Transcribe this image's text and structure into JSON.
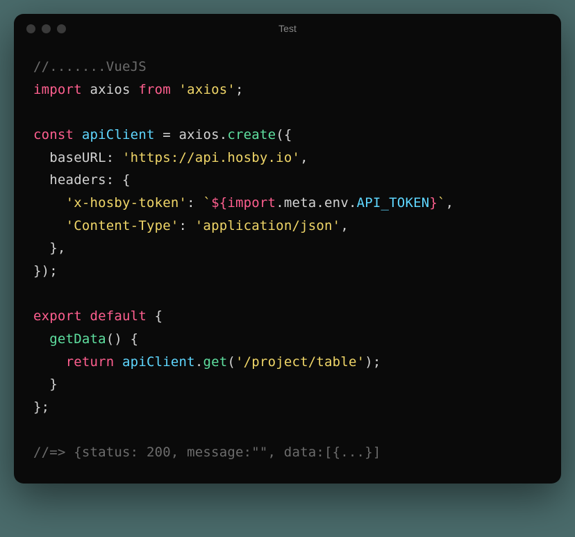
{
  "window": {
    "title": "Test"
  },
  "code": {
    "lines": [
      {
        "segments": [
          {
            "cls": "c-comment",
            "t": "//.......VueJS"
          }
        ]
      },
      {
        "segments": [
          {
            "cls": "c-keyword",
            "t": "import"
          },
          {
            "cls": "c-import-name",
            "t": " axios "
          },
          {
            "cls": "c-keyword",
            "t": "from"
          },
          {
            "cls": "c-punct",
            "t": " "
          },
          {
            "cls": "c-string",
            "t": "'axios'"
          },
          {
            "cls": "c-punct",
            "t": ";"
          }
        ]
      },
      {
        "segments": [
          {
            "cls": "c-punct",
            "t": " "
          }
        ]
      },
      {
        "segments": [
          {
            "cls": "c-keyword",
            "t": "const"
          },
          {
            "cls": "c-punct",
            "t": " "
          },
          {
            "cls": "c-var",
            "t": "apiClient"
          },
          {
            "cls": "c-punct",
            "t": " = axios."
          },
          {
            "cls": "c-func",
            "t": "create"
          },
          {
            "cls": "c-punct",
            "t": "({"
          }
        ]
      },
      {
        "segments": [
          {
            "cls": "c-punct",
            "t": "  "
          },
          {
            "cls": "c-prop",
            "t": "baseURL"
          },
          {
            "cls": "c-punct",
            "t": ": "
          },
          {
            "cls": "c-string",
            "t": "'https://api.hosby.io'"
          },
          {
            "cls": "c-punct",
            "t": ","
          }
        ]
      },
      {
        "segments": [
          {
            "cls": "c-punct",
            "t": "  "
          },
          {
            "cls": "c-prop",
            "t": "headers"
          },
          {
            "cls": "c-punct",
            "t": ": {"
          }
        ]
      },
      {
        "segments": [
          {
            "cls": "c-punct",
            "t": "    "
          },
          {
            "cls": "c-string",
            "t": "'x-hosby-token'"
          },
          {
            "cls": "c-punct",
            "t": ": "
          },
          {
            "cls": "c-string",
            "t": "`"
          },
          {
            "cls": "c-templ",
            "t": "${"
          },
          {
            "cls": "c-keyword",
            "t": "import"
          },
          {
            "cls": "c-punct",
            "t": "."
          },
          {
            "cls": "c-meta",
            "t": "meta"
          },
          {
            "cls": "c-punct",
            "t": "."
          },
          {
            "cls": "c-meta",
            "t": "env"
          },
          {
            "cls": "c-punct",
            "t": "."
          },
          {
            "cls": "c-env",
            "t": "API_TOKEN"
          },
          {
            "cls": "c-templ",
            "t": "}"
          },
          {
            "cls": "c-string",
            "t": "`"
          },
          {
            "cls": "c-punct",
            "t": ","
          }
        ]
      },
      {
        "segments": [
          {
            "cls": "c-punct",
            "t": "    "
          },
          {
            "cls": "c-string",
            "t": "'Content-Type'"
          },
          {
            "cls": "c-punct",
            "t": ": "
          },
          {
            "cls": "c-string",
            "t": "'application/json'"
          },
          {
            "cls": "c-punct",
            "t": ","
          }
        ]
      },
      {
        "segments": [
          {
            "cls": "c-punct",
            "t": "  },"
          }
        ]
      },
      {
        "segments": [
          {
            "cls": "c-punct",
            "t": "});"
          }
        ]
      },
      {
        "segments": [
          {
            "cls": "c-punct",
            "t": " "
          }
        ]
      },
      {
        "segments": [
          {
            "cls": "c-keyword",
            "t": "export"
          },
          {
            "cls": "c-punct",
            "t": " "
          },
          {
            "cls": "c-keyword",
            "t": "default"
          },
          {
            "cls": "c-punct",
            "t": " {"
          }
        ]
      },
      {
        "segments": [
          {
            "cls": "c-punct",
            "t": "  "
          },
          {
            "cls": "c-func",
            "t": "getData"
          },
          {
            "cls": "c-punct",
            "t": "() {"
          }
        ]
      },
      {
        "segments": [
          {
            "cls": "c-punct",
            "t": "    "
          },
          {
            "cls": "c-return",
            "t": "return"
          },
          {
            "cls": "c-punct",
            "t": " "
          },
          {
            "cls": "c-var",
            "t": "apiClient"
          },
          {
            "cls": "c-punct",
            "t": "."
          },
          {
            "cls": "c-func",
            "t": "get"
          },
          {
            "cls": "c-punct",
            "t": "("
          },
          {
            "cls": "c-string",
            "t": "'/project/table'"
          },
          {
            "cls": "c-punct",
            "t": ");"
          }
        ]
      },
      {
        "segments": [
          {
            "cls": "c-punct",
            "t": "  }"
          }
        ]
      },
      {
        "segments": [
          {
            "cls": "c-punct",
            "t": "};"
          }
        ]
      },
      {
        "segments": [
          {
            "cls": "c-punct",
            "t": " "
          }
        ]
      },
      {
        "segments": [
          {
            "cls": "c-comment",
            "t": "//=> {status: 200, message:\"\", data:[{...}]"
          }
        ]
      }
    ]
  }
}
